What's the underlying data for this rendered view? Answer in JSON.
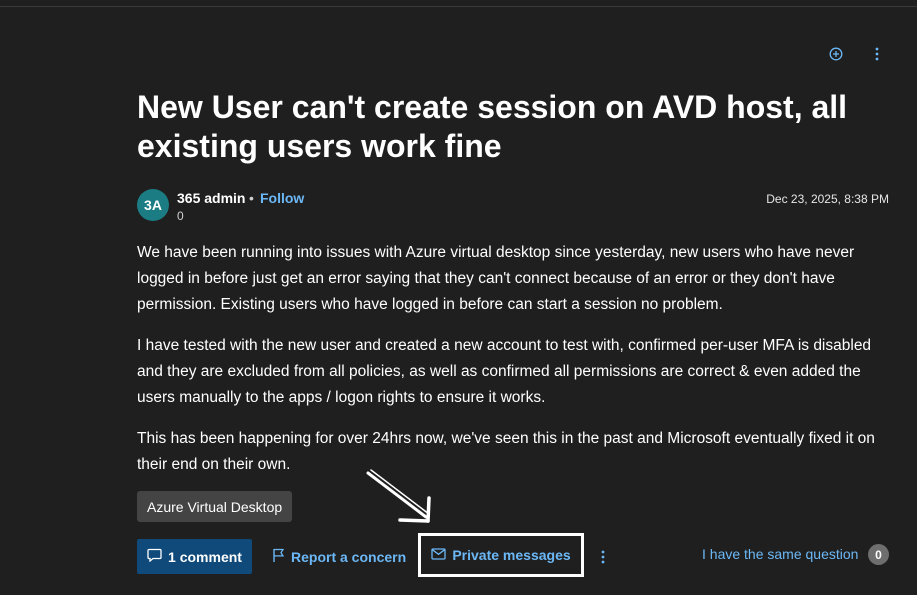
{
  "icons": {
    "add_icon": "circle-plus-icon",
    "more_icon": "vertical-ellipsis-icon",
    "comment_icon": "speech-bubble-icon",
    "report_icon": "flag-icon",
    "mail_icon": "envelope-icon",
    "annotation": "hand-drawn-arrow"
  },
  "colors": {
    "background": "#1f1f1f",
    "link": "#6cb8f6",
    "primary_button": "#0f4a7a",
    "avatar": "#1b7c83",
    "tag_bg": "#444444",
    "highlight_box": "#ffffff"
  },
  "post": {
    "title": "New User can't create session on AVD host, all existing users work fine",
    "author": {
      "initials": "3A",
      "name": "365 admin",
      "separator": "•",
      "follow_label": "Follow",
      "reputation": "0"
    },
    "date": "Dec 23, 2025, 8:38 PM",
    "paragraphs": [
      "We have been running into issues with Azure virtual desktop since yesterday, new users who have never logged in before just get an error saying that they can't connect because of an error or they don't have permission. Existing users who have logged in before can start a session no problem.",
      "I have tested with the new user and created a new account to test with, confirmed per-user MFA is disabled and they are excluded from all policies, as well as confirmed all permissions are correct & even added the users manually to the apps / logon rights to ensure it works.",
      "This has been happening for over 24hrs now, we've seen this in the past and Microsoft eventually fixed it on their end on their own."
    ],
    "tag": "Azure Virtual Desktop"
  },
  "actions": {
    "comment_label": "1 comment",
    "report_label": "Report a concern",
    "private_messages_label": "Private messages",
    "same_question_label": "I have the same question",
    "same_question_count": "0"
  }
}
